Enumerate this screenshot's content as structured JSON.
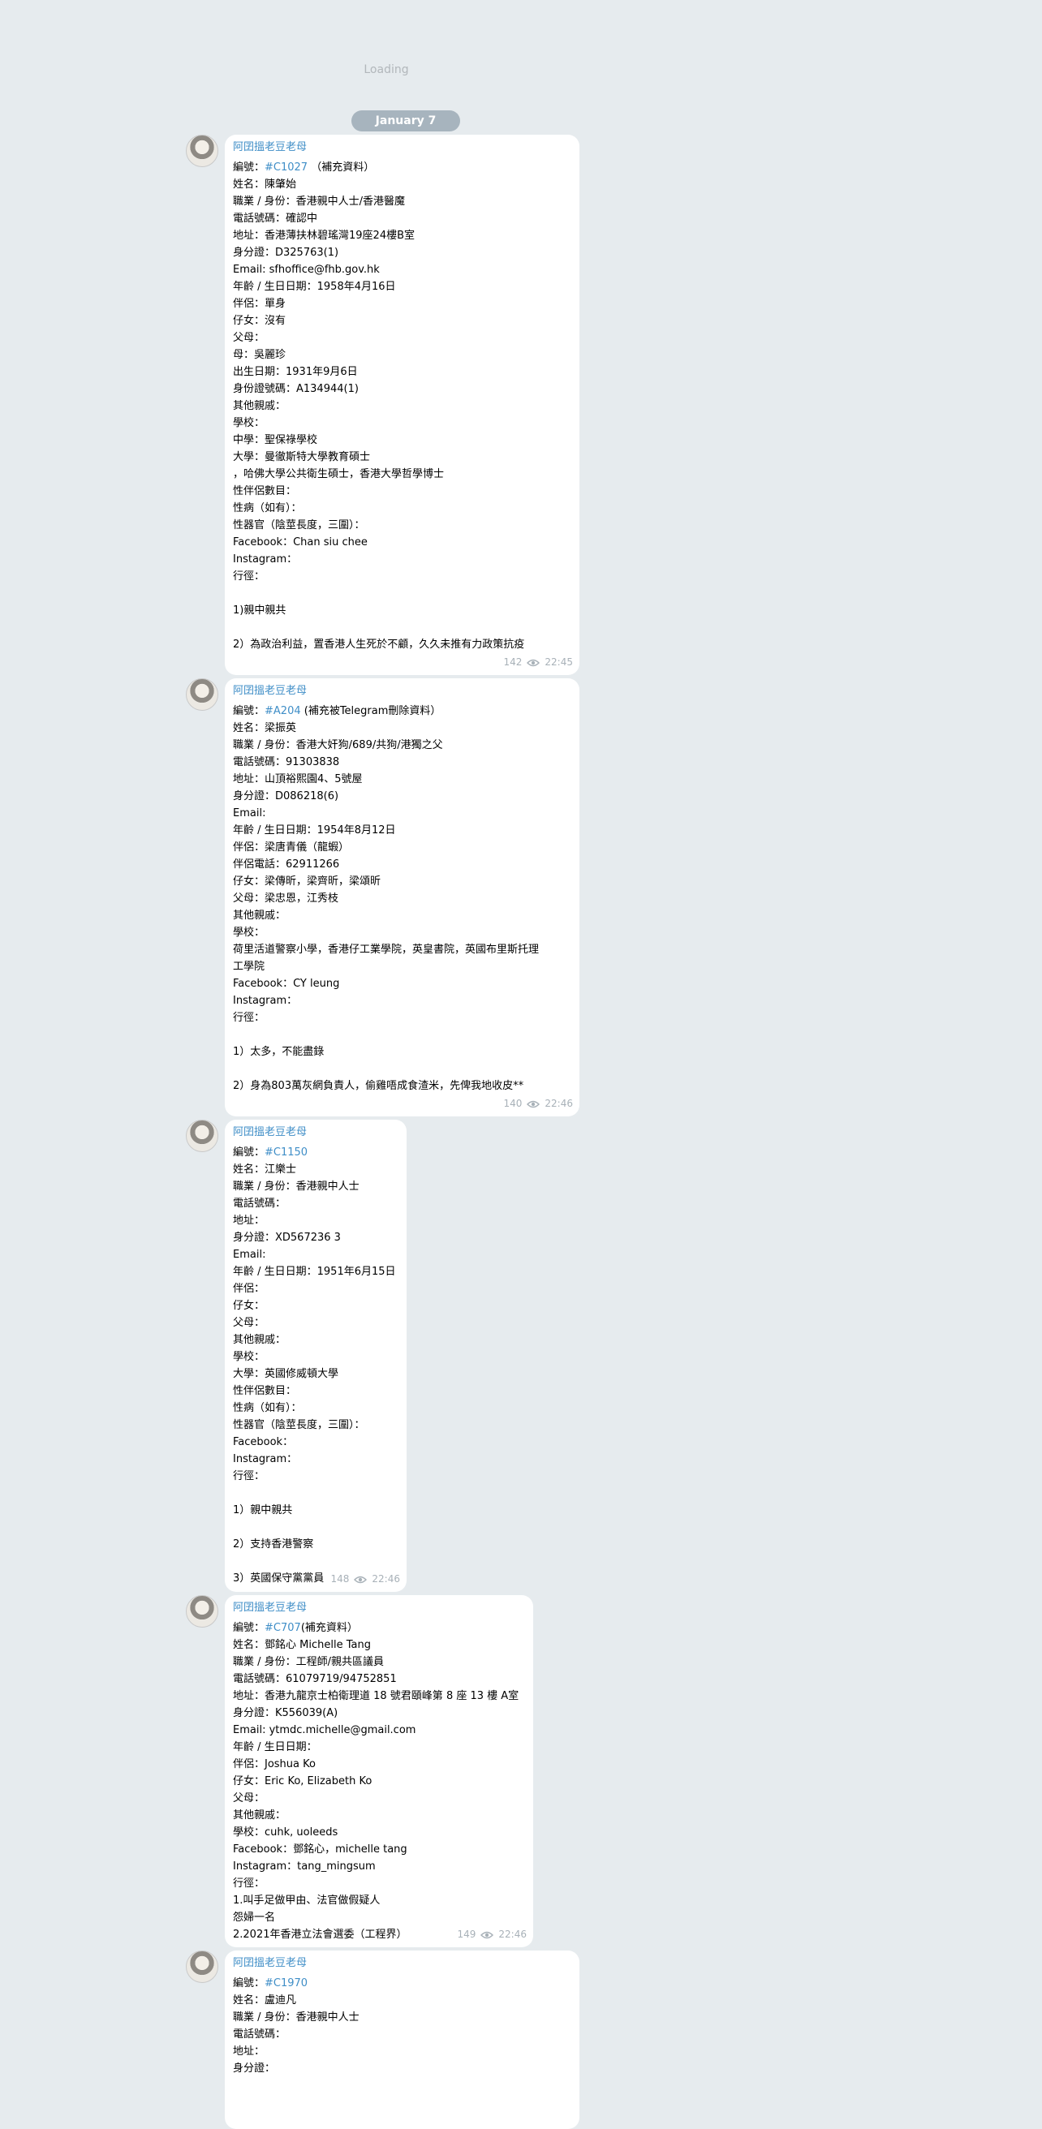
{
  "loading_label": "Loading",
  "date_label": "January 7",
  "accent_color": "#3f8ec7",
  "messages": [
    {
      "sender": "阿囝搵老豆老母",
      "views": "142",
      "time": "22:45",
      "lines": [
        {
          "pre": "編號：",
          "tag": "#C1027",
          "post": " （補充資料）"
        },
        {
          "text": "姓名：陳肇始"
        },
        {
          "text": "職業 / 身份：香港親中人士/香港醫魔"
        },
        {
          "text": "電話號碼：確認中"
        },
        {
          "text": "地址：香港薄扶林碧瑤灣19座24樓B室"
        },
        {
          "text": "身分證：D325763(1)"
        },
        {
          "text": "Email: sfhoffice@fhb.gov.hk"
        },
        {
          "text": "年齡 / 生日日期：1958年4月16日"
        },
        {
          "text": "伴侶：單身"
        },
        {
          "text": "仔女：沒有"
        },
        {
          "text": "父母："
        },
        {
          "text": "母：吳麗珍"
        },
        {
          "text": "出生日期：1931年9月6日"
        },
        {
          "text": "身份證號碼：A134944(1)"
        },
        {
          "text": "其他親戚："
        },
        {
          "text": "學校："
        },
        {
          "text": "中學：聖保祿學校"
        },
        {
          "text": "大學：曼徹斯特大學教育碩士"
        },
        {
          "text": "，哈佛大學公共衛生碩士，香港大學哲學博士"
        },
        {
          "text": "性伴侶數目："
        },
        {
          "text": "性病（如有）："
        },
        {
          "text": "性器官（陰莖長度，三圍）："
        },
        {
          "text": "Facebook：Chan siu chee"
        },
        {
          "text": "Instagram："
        },
        {
          "text": "行徑："
        },
        {
          "text": ""
        },
        {
          "text": "1)親中親共"
        },
        {
          "text": ""
        },
        {
          "text": "2）為政治利益，置香港人生死於不顧，久久未推有力政策抗疫"
        }
      ]
    },
    {
      "sender": "阿囝搵老豆老母",
      "views": "140",
      "time": "22:46",
      "lines": [
        {
          "pre": "編號：",
          "tag": "#A204",
          "post": " (補充被Telegram刪除資料）"
        },
        {
          "text": "姓名：梁振英"
        },
        {
          "text": "職業 / 身份：香港大奸狗/689/共狗/港獨之父"
        },
        {
          "text": "電話號碼：91303838"
        },
        {
          "text": "地址：山頂裕熙園4、5號屋"
        },
        {
          "text": "身分證：D086218(6)"
        },
        {
          "text": "Email:"
        },
        {
          "text": "年齡 / 生日日期：1954年8月12日"
        },
        {
          "text": "伴侶：梁唐青儀（龍蝦）"
        },
        {
          "text": "伴侶電話：62911266"
        },
        {
          "text": "仔女：梁傳昕，梁齊昕，梁頌昕"
        },
        {
          "text": "父母：梁忠恩，江秀枝"
        },
        {
          "text": "其他親戚："
        },
        {
          "text": "學校："
        },
        {
          "text": "荷里活道警察小學，香港仔工業學院，英皇書院，英國布里斯托理"
        },
        {
          "text": "工學院"
        },
        {
          "text": "Facebook：CY leung"
        },
        {
          "text": "Instagram："
        },
        {
          "text": "行徑："
        },
        {
          "text": ""
        },
        {
          "text": "1）太多，不能盡錄"
        },
        {
          "text": ""
        },
        {
          "text": "2）身為803萬灰網負責人，偷雞唔成食渣米，先俾我地收皮**"
        }
      ]
    },
    {
      "sender": "阿囝搵老豆老母",
      "views": "148",
      "time": "22:46",
      "lines": [
        {
          "pre": "編號：",
          "tag": "#C1150",
          "post": ""
        },
        {
          "text": "姓名：江樂士"
        },
        {
          "text": "職業 / 身份：香港親中人士"
        },
        {
          "text": "電話號碼："
        },
        {
          "text": "地址："
        },
        {
          "text": "身分證：XD567236 3"
        },
        {
          "text": "Email:"
        },
        {
          "text": "年齡 / 生日日期：1951年6月15日"
        },
        {
          "text": "伴侶："
        },
        {
          "text": "仔女："
        },
        {
          "text": "父母："
        },
        {
          "text": "其他親戚："
        },
        {
          "text": "學校："
        },
        {
          "text": "大學：英國修威頓大學"
        },
        {
          "text": "性伴侶數目："
        },
        {
          "text": "性病（如有）："
        },
        {
          "text": "性器官（陰莖長度，三圍）："
        },
        {
          "text": "Facebook："
        },
        {
          "text": "Instagram："
        },
        {
          "text": "行徑："
        },
        {
          "text": ""
        },
        {
          "text": "1）親中親共"
        },
        {
          "text": ""
        },
        {
          "text": "2）支持香港警察"
        },
        {
          "text": ""
        },
        {
          "text": "3）英國保守黨黨員"
        }
      ]
    },
    {
      "sender": "阿囝搵老豆老母",
      "views": "149",
      "time": "22:46",
      "lines": [
        {
          "pre": "編號：",
          "tag": "#C707",
          "post": "(補充資料）"
        },
        {
          "text": "姓名：鄧銘心 Michelle Tang"
        },
        {
          "text": "職業 / 身份：工程師/親共區議員"
        },
        {
          "text": "電話號碼：61079719/94752851"
        },
        {
          "text": "地址：香港九龍京士柏衛理道 18 號君頤峰第 8 座 13 樓 A室"
        },
        {
          "text": "身分證：K556039(A)"
        },
        {
          "text": "Email: ytmdc.michelle@gmail.com"
        },
        {
          "text": "年齡 / 生日日期："
        },
        {
          "text": "伴侶：Joshua Ko"
        },
        {
          "text": "仔女：Eric Ko, Elizabeth Ko"
        },
        {
          "text": "父母："
        },
        {
          "text": "其他親戚："
        },
        {
          "text": "學校：cuhk, uoleeds"
        },
        {
          "text": "Facebook：鄧銘心，michelle tang"
        },
        {
          "text": "Instagram：tang_mingsum"
        },
        {
          "text": "行徑："
        },
        {
          "text": "1.叫手足做甲由、法官做假疑人"
        },
        {
          "text": "怨婦一名"
        },
        {
          "text": "2.2021年香港立法會選委（工程界）"
        }
      ]
    },
    {
      "sender": "阿囝搵老豆老母",
      "views": "",
      "time": "",
      "lines": [
        {
          "pre": "編號：",
          "tag": "#C1970",
          "post": ""
        },
        {
          "text": "姓名：盧迪凡"
        },
        {
          "text": "職業 / 身份：香港親中人士"
        },
        {
          "text": "電話號碼："
        },
        {
          "text": "地址："
        },
        {
          "text": "身分證："
        }
      ]
    }
  ]
}
